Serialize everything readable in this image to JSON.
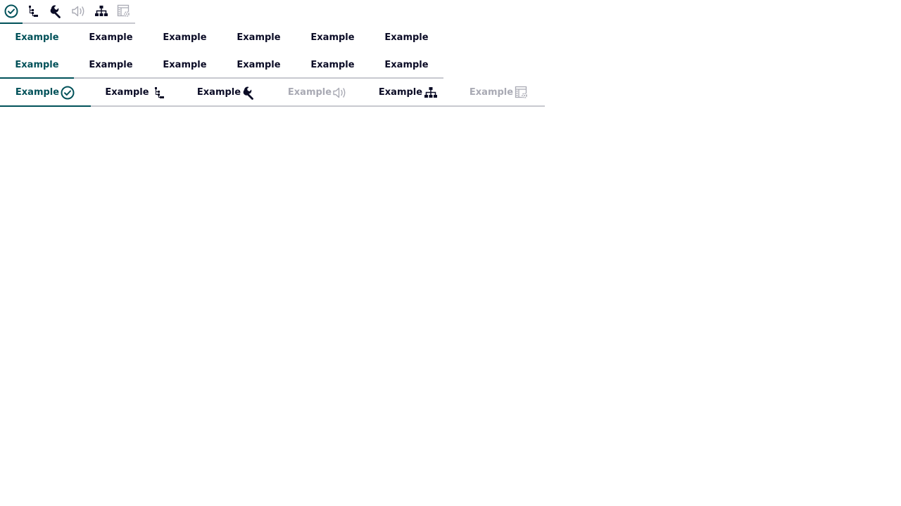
{
  "colors": {
    "accent": "#005159",
    "text": "#0b0c26",
    "disabled": "#a9aab4",
    "divider": "#c8c9cf"
  },
  "icon_tabs": [
    {
      "icon": "check-circle-icon",
      "selected": true,
      "disabled": false
    },
    {
      "icon": "tree-list-icon",
      "selected": false,
      "disabled": false
    },
    {
      "icon": "wrench-icon",
      "selected": false,
      "disabled": false
    },
    {
      "icon": "speaker-icon",
      "selected": false,
      "disabled": true
    },
    {
      "icon": "hierarchy-icon",
      "selected": false,
      "disabled": false
    },
    {
      "icon": "settings-table-icon",
      "selected": false,
      "disabled": true
    }
  ],
  "text_tabs_row1": [
    {
      "label": "Example",
      "selected": true
    },
    {
      "label": "Example",
      "selected": false
    },
    {
      "label": "Example",
      "selected": false
    },
    {
      "label": "Example",
      "selected": false
    },
    {
      "label": "Example",
      "selected": false
    },
    {
      "label": "Example",
      "selected": false
    }
  ],
  "text_tabs_row2": [
    {
      "label": "Example",
      "selected": true
    },
    {
      "label": "Example",
      "selected": false
    },
    {
      "label": "Example",
      "selected": false
    },
    {
      "label": "Example",
      "selected": false
    },
    {
      "label": "Example",
      "selected": false
    },
    {
      "label": "Example",
      "selected": false
    }
  ],
  "icon_text_tabs": [
    {
      "label": "Example",
      "icon": "check-circle-icon",
      "selected": true,
      "disabled": false
    },
    {
      "label": "Example",
      "icon": "tree-list-icon",
      "selected": false,
      "disabled": false
    },
    {
      "label": "Example",
      "icon": "wrench-icon",
      "selected": false,
      "disabled": false
    },
    {
      "label": "Example",
      "icon": "speaker-icon",
      "selected": false,
      "disabled": true
    },
    {
      "label": "Example",
      "icon": "hierarchy-icon",
      "selected": false,
      "disabled": false
    },
    {
      "label": "Example",
      "icon": "settings-table-icon",
      "selected": false,
      "disabled": true
    }
  ]
}
